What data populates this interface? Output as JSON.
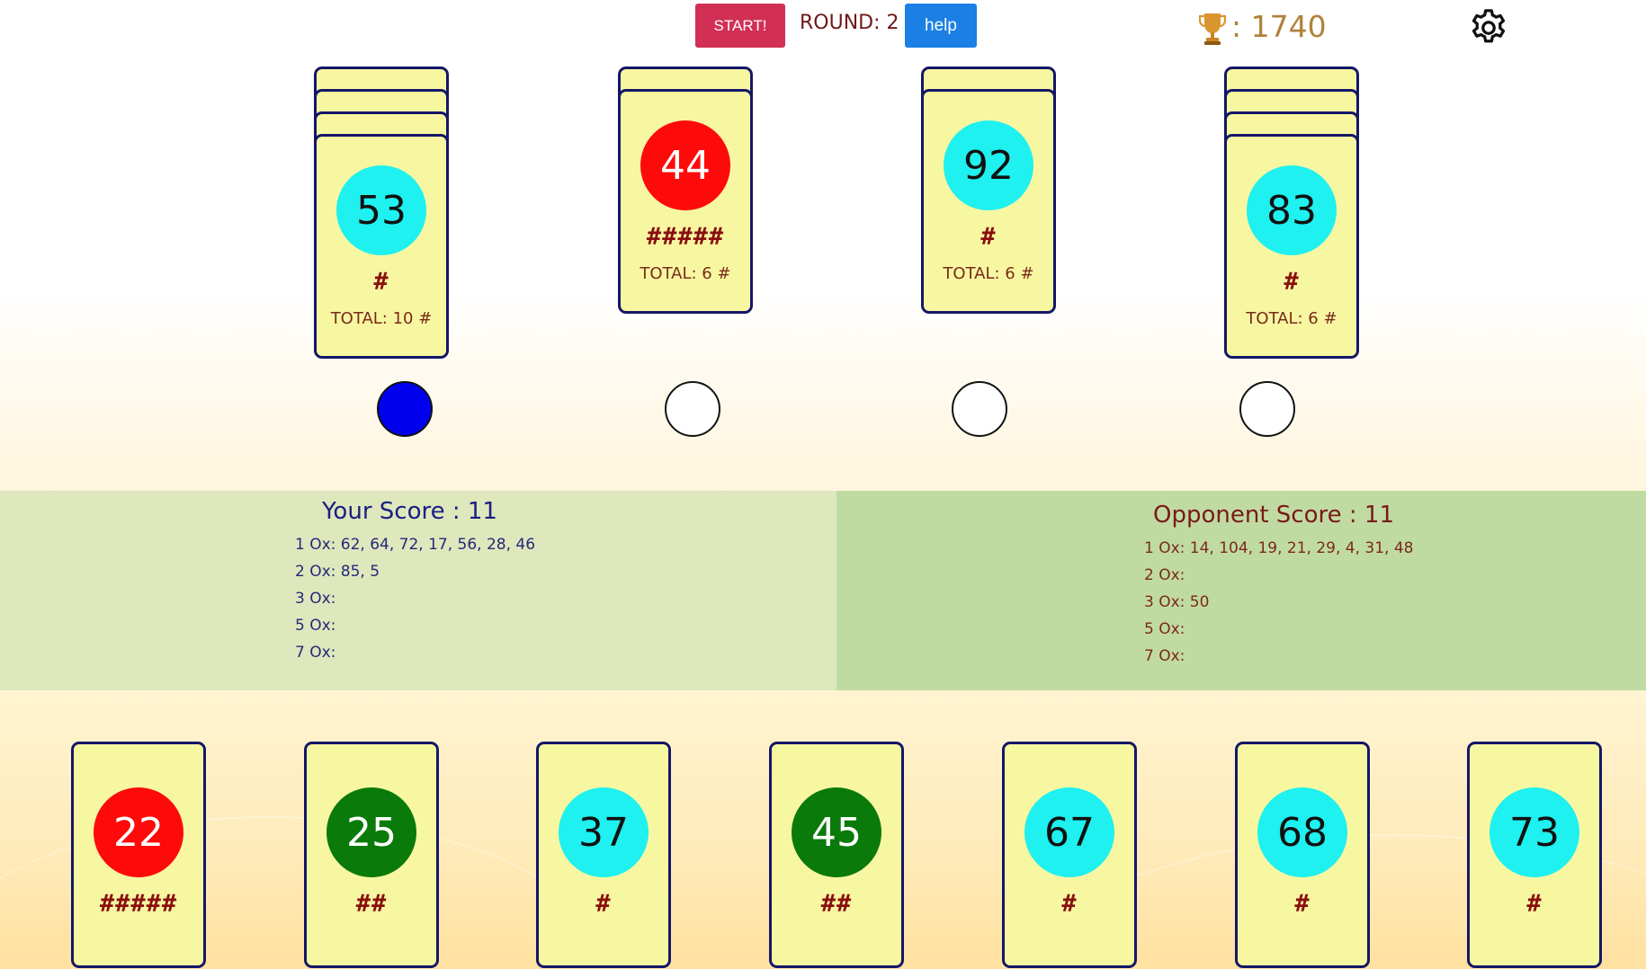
{
  "header": {
    "start_label": "START!",
    "round_text": "ROUND: 2",
    "help_label": "help",
    "trophy_score": ": 1740"
  },
  "rows": [
    {
      "top_value": "53",
      "color": "#1ff0f0",
      "text_color": "#111111",
      "hashes": "#",
      "total": "TOTAL: 10 #",
      "stacked_behind": 3,
      "selected": true
    },
    {
      "top_value": "44",
      "color": "#ff0a0a",
      "text_color": "#ffffff",
      "hashes": "#####",
      "total": "TOTAL: 6 #",
      "stacked_behind": 1,
      "selected": false
    },
    {
      "top_value": "92",
      "color": "#1ff0f0",
      "text_color": "#111111",
      "hashes": "#",
      "total": "TOTAL: 6 #",
      "stacked_behind": 1,
      "selected": false
    },
    {
      "top_value": "83",
      "color": "#1ff0f0",
      "text_color": "#111111",
      "hashes": "#",
      "total": "TOTAL: 6 #",
      "stacked_behind": 3,
      "selected": false
    }
  ],
  "your_score": {
    "title": "Your Score : 11",
    "lines": [
      "1 Ox: 62, 64, 72, 17, 56, 28, 46",
      "2 Ox: 85, 5",
      "3 Ox:",
      "5 Ox:",
      "7 Ox:"
    ]
  },
  "opponent_score": {
    "title": "Opponent Score : 11",
    "lines": [
      "1 Ox: 14, 104, 19, 21, 29, 4, 31, 48",
      "2 Ox:",
      "3 Ox: 50",
      "5 Ox:",
      "7 Ox:"
    ]
  },
  "hand": [
    {
      "value": "22",
      "color": "#ff0a0a",
      "text_color": "#ffffff",
      "hashes": "#####"
    },
    {
      "value": "25",
      "color": "#0a7a0a",
      "text_color": "#ffffff",
      "hashes": "##"
    },
    {
      "value": "37",
      "color": "#1ff0f0",
      "text_color": "#111111",
      "hashes": "#"
    },
    {
      "value": "45",
      "color": "#0a7a0a",
      "text_color": "#ffffff",
      "hashes": "##"
    },
    {
      "value": "67",
      "color": "#1ff0f0",
      "text_color": "#111111",
      "hashes": "#"
    },
    {
      "value": "68",
      "color": "#1ff0f0",
      "text_color": "#111111",
      "hashes": "#"
    },
    {
      "value": "73",
      "color": "#1ff0f0",
      "text_color": "#111111",
      "hashes": "#"
    }
  ],
  "icons": {
    "trophy": "trophy-icon",
    "settings": "gear-icon"
  }
}
